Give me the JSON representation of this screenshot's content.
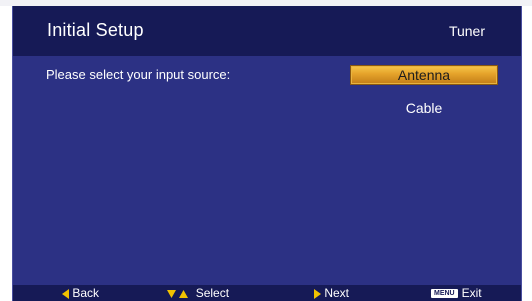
{
  "header": {
    "title": "Initial Setup",
    "section": "Tuner"
  },
  "prompt": "Please select your input source:",
  "options": [
    {
      "label": "Antenna",
      "selected": true
    },
    {
      "label": "Cable",
      "selected": false
    }
  ],
  "footer": {
    "back": "Back",
    "select": "Select",
    "next": "Next",
    "menu_key": "MENU",
    "exit": "Exit"
  },
  "colors": {
    "panel": "#2c3184",
    "header_bar": "#161a56",
    "highlight": "#e4a22a",
    "arrow_icons": "#f2c200"
  }
}
